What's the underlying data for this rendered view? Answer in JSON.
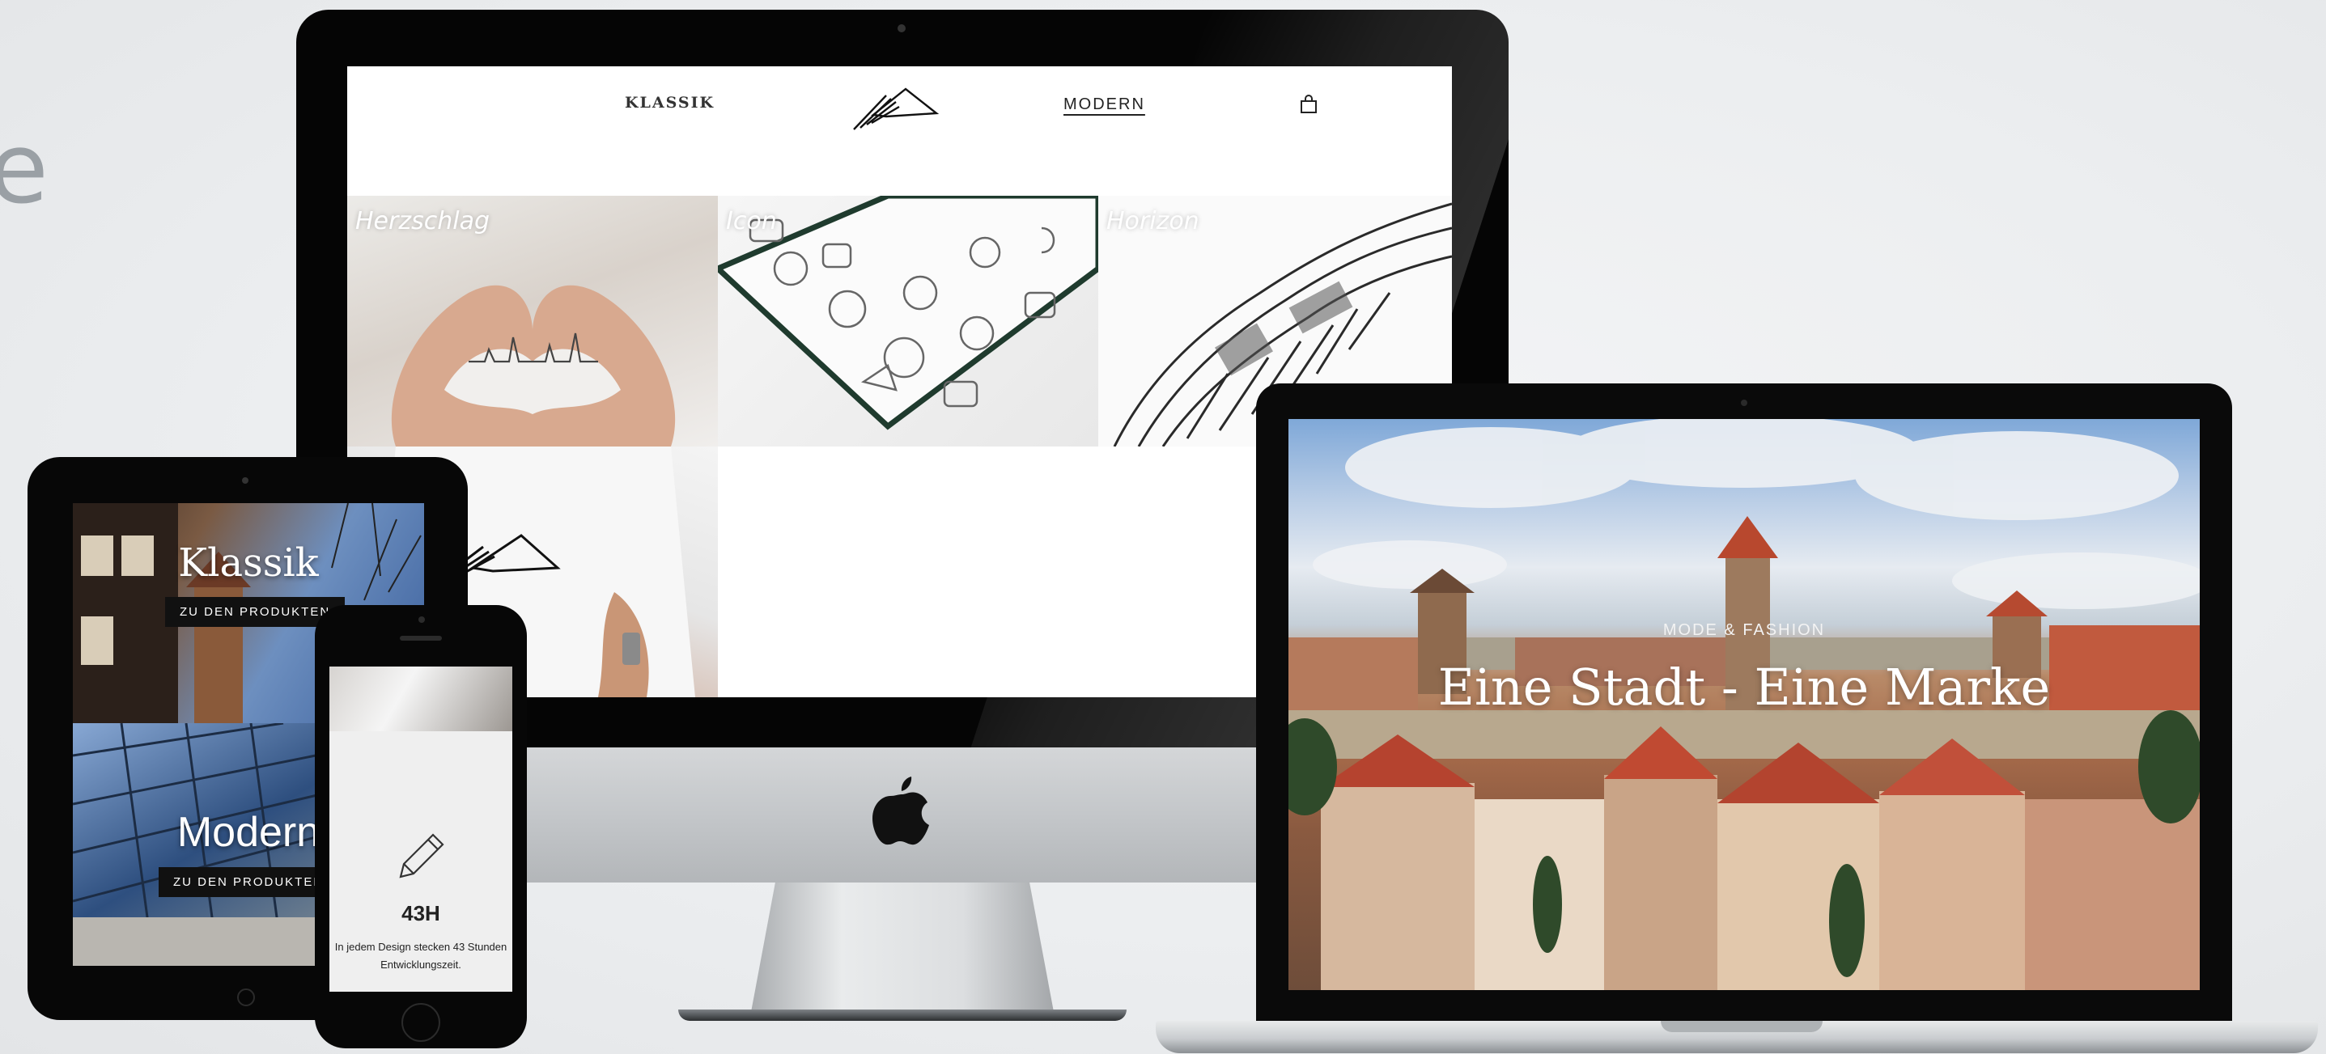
{
  "background_fragment": "e",
  "desktop_site": {
    "nav": {
      "left_link": "KLASSIK",
      "right_link": "MODERN",
      "logo": "brand-logo-icon",
      "cart": "shopping-bag-icon"
    },
    "tiles": [
      {
        "label": "Herzschlag"
      },
      {
        "label": "Icon"
      },
      {
        "label": "Horizon"
      }
    ]
  },
  "laptop_site": {
    "hero_subtitle": "MODE & FASHION",
    "hero_title": "Eine Stadt - Eine Marke"
  },
  "tablet_site": {
    "panels": [
      {
        "heading": "Klassik",
        "button": "ZU DEN PRODUKTEN"
      },
      {
        "heading": "Modern",
        "button": "ZU DEN PRODUKTEN"
      }
    ]
  },
  "phone_site": {
    "icon": "pencil-icon",
    "stat_title": "43H",
    "stat_text_line1": "In jedem Design stecken 43 Stunden",
    "stat_text_line2": "Entwicklungszeit."
  },
  "device_icons": {
    "imac_logo": "apple-logo-icon"
  },
  "colors": {
    "background": "#eceef0",
    "bezel": "#050505",
    "site_bg": "#ffffff",
    "button_bg": "#111111"
  }
}
